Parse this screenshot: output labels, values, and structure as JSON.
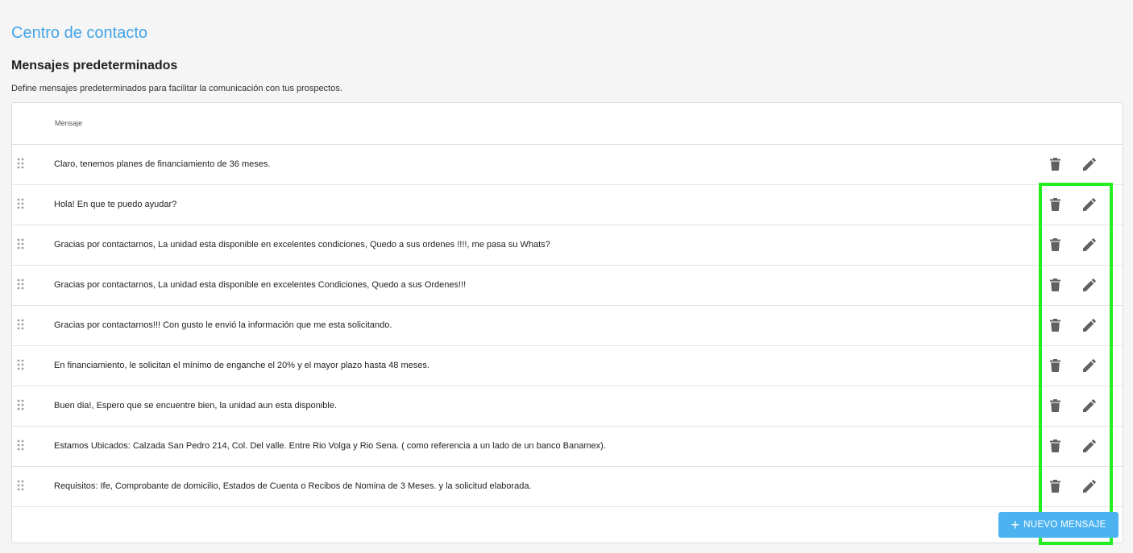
{
  "header": {
    "app_title": "Centro de contacto"
  },
  "section": {
    "title": "Mensajes predeterminados",
    "description": "Define mensajes predeterminados para facilitar la comunicación con tus prospectos."
  },
  "table": {
    "column_header": "Mensaje",
    "rows": [
      {
        "text": "Claro, tenemos planes de financiamiento de 36 meses."
      },
      {
        "text": "Hola! En que te puedo ayudar?"
      },
      {
        "text": "Gracias por contactarnos, La unidad esta disponible en excelentes condiciones, Quedo a sus ordenes !!!!, me pasa su Whats?"
      },
      {
        "text": "Gracias por contactarnos, La unidad esta disponible en excelentes Condiciones, Quedo a sus Ordenes!!!"
      },
      {
        "text": "Gracias por contactarnos!!! Con gusto le envió la información que me esta solicitando."
      },
      {
        "text": "En financiamiento, le solicitan el mínimo de enganche el 20% y el mayor plazo hasta 48 meses."
      },
      {
        "text": "Buen dia!, Espero que se encuentre bien, la unidad aun esta disponible."
      },
      {
        "text": "Estamos Ubicados: Calzada San Pedro 214, Col. Del valle. Entre Rio Volga y Rio Sena. ( como referencia a un lado de un banco Banamex)."
      },
      {
        "text": "Requisitos: Ife, Comprobante de domicilio, Estados de Cuenta o Recibos de Nomina de 3 Meses. y la solicitud elaborada."
      }
    ],
    "row_actions": {
      "delete_icon": "trash-icon",
      "edit_icon": "pencil-icon"
    }
  },
  "actions": {
    "add_button_label": "NUEVO MENSAJE",
    "add_icon": "plus-icon"
  },
  "colors": {
    "accent": "#42a5e8",
    "button": "#4db3f0",
    "icon": "#616161",
    "highlight": "#22ee22"
  }
}
